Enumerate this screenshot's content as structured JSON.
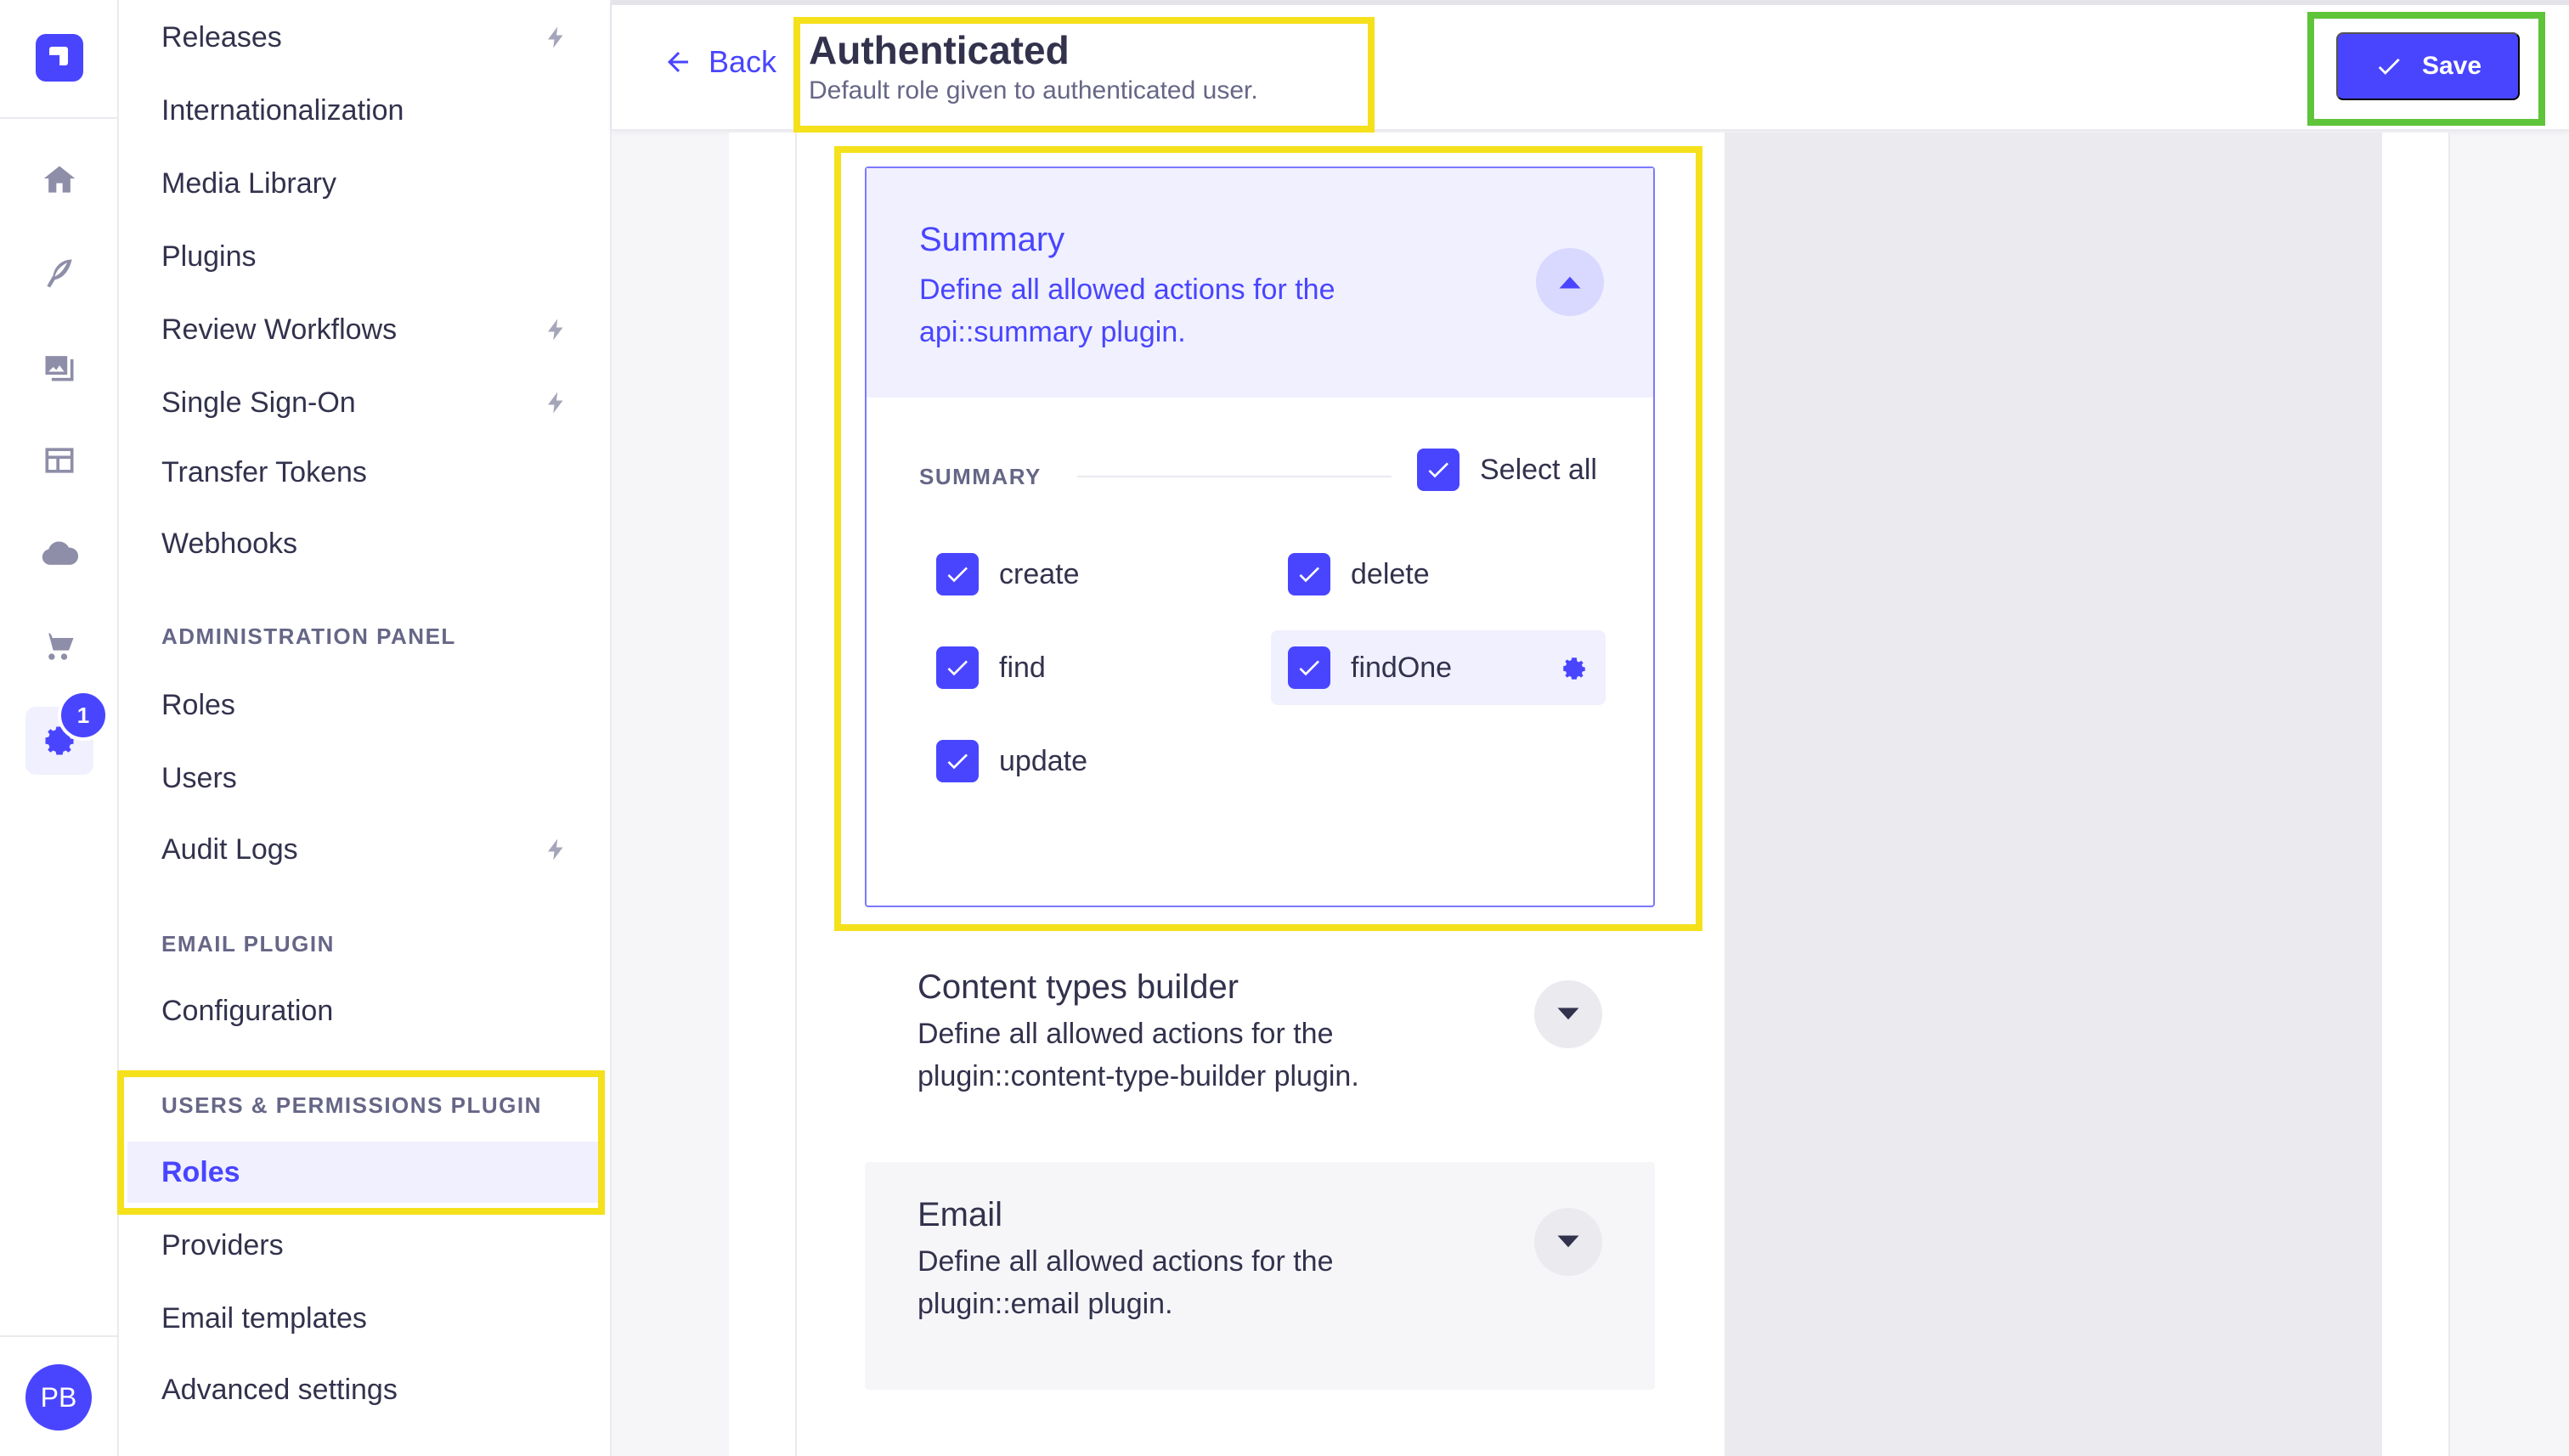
{
  "rail": {
    "badge_count": "1",
    "avatar_initials": "PB"
  },
  "subnav": {
    "items_top": [
      "Releases",
      "Internationalization",
      "Media Library",
      "Plugins",
      "Review Workflows",
      "Single Sign-On",
      "Transfer Tokens",
      "Webhooks"
    ],
    "admin_section": "ADMINISTRATION PANEL",
    "admin_items": [
      "Roles",
      "Users",
      "Audit Logs"
    ],
    "email_section": "EMAIL PLUGIN",
    "email_items": [
      "Configuration"
    ],
    "up_section": "USERS & PERMISSIONS PLUGIN",
    "up_items": [
      "Roles",
      "Providers",
      "Email templates",
      "Advanced settings"
    ]
  },
  "header": {
    "back_label": "Back",
    "title": "Authenticated",
    "subtitle": "Default role given to authenticated user.",
    "save_label": "Save"
  },
  "summary": {
    "title": "Summary",
    "description": "Define all allowed actions for the api::summary plugin.",
    "section_label": "SUMMARY",
    "select_all_label": "Select all",
    "permissions": [
      "create",
      "delete",
      "find",
      "findOne",
      "update"
    ]
  },
  "content_types_builder": {
    "title": "Content types builder",
    "description": "Define all allowed actions for the plugin::content-type-builder plugin."
  },
  "email": {
    "title": "Email",
    "description": "Define all allowed actions for the plugin::email plugin."
  },
  "colors": {
    "primary": "#4945ff",
    "primary_light": "#f0f0ff",
    "highlight_yellow": "#f5e01c",
    "highlight_green": "#5ec43a"
  }
}
